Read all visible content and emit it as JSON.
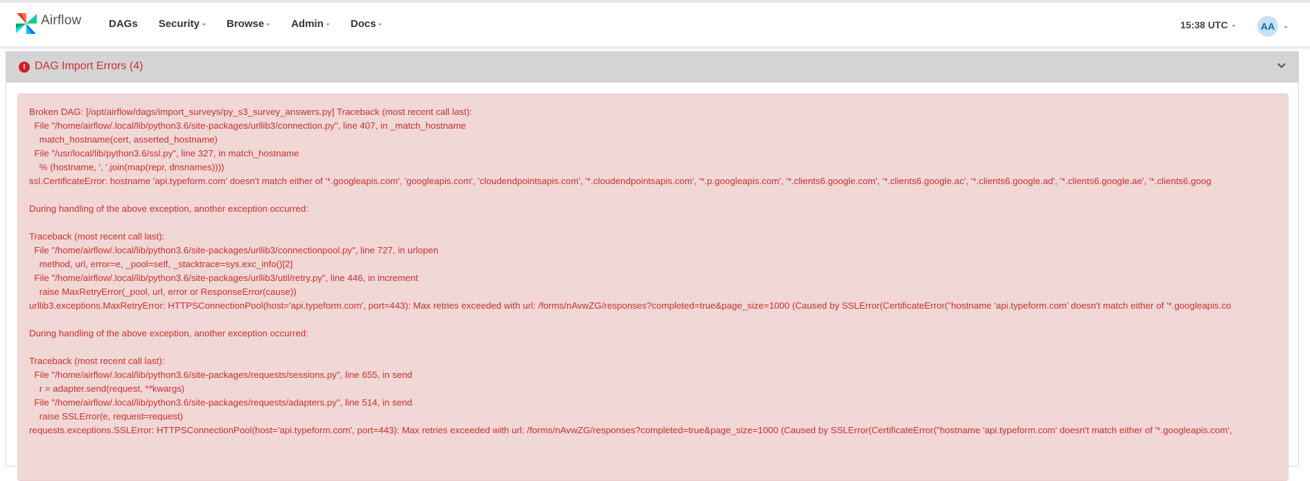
{
  "header": {
    "brand": "Airflow",
    "nav": [
      {
        "label": "DAGs",
        "has_menu": false
      },
      {
        "label": "Security",
        "has_menu": true
      },
      {
        "label": "Browse",
        "has_menu": true
      },
      {
        "label": "Admin",
        "has_menu": true
      },
      {
        "label": "Docs",
        "has_menu": true
      }
    ],
    "clock": "15:38 UTC",
    "user_initials": "AA"
  },
  "panel": {
    "title": "DAG Import Errors (4)",
    "alert_icon": "!",
    "error_lines": [
      "Broken DAG: [/opt/airflow/dags/import_surveys/py_s3_survey_answers.py] Traceback (most recent call last):",
      "  File \"/home/airflow/.local/lib/python3.6/site-packages/urllib3/connection.py\", line 407, in _match_hostname",
      "    match_hostname(cert, asserted_hostname)",
      "  File \"/usr/local/lib/python3.6/ssl.py\", line 327, in match_hostname",
      "    % (hostname, ', '.join(map(repr, dnsnames))))",
      "ssl.CertificateError: hostname 'api.typeform.com' doesn't match either of '*.googleapis.com', 'googleapis.com', 'cloudendpointsapis.com', '*.cloudendpointsapis.com', '*.p.googleapis.com', '*.clients6.google.com', '*.clients6.google.ac', '*.clients6.google.ad', '*.clients6.google.ae', '*.clients6.goog",
      "",
      "During handling of the above exception, another exception occurred:",
      "",
      "Traceback (most recent call last):",
      "  File \"/home/airflow/.local/lib/python3.6/site-packages/urllib3/connectionpool.py\", line 727, in urlopen",
      "    method, url, error=e, _pool=self, _stacktrace=sys.exc_info()[2]",
      "  File \"/home/airflow/.local/lib/python3.6/site-packages/urllib3/util/retry.py\", line 446, in increment",
      "    raise MaxRetryError(_pool, url, error or ResponseError(cause))",
      "urllib3.exceptions.MaxRetryError: HTTPSConnectionPool(host='api.typeform.com', port=443): Max retries exceeded with url: /forms/nAvwZG/responses?completed=true&page_size=1000 (Caused by SSLError(CertificateError(\"hostname 'api.typeform.com' doesn't match either of '*.googleapis.co",
      "",
      "During handling of the above exception, another exception occurred:",
      "",
      "Traceback (most recent call last):",
      "  File \"/home/airflow/.local/lib/python3.6/site-packages/requests/sessions.py\", line 655, in send",
      "    r = adapter.send(request, **kwargs)",
      "  File \"/home/airflow/.local/lib/python3.6/site-packages/requests/adapters.py\", line 514, in send",
      "    raise SSLError(e, request=request)",
      "requests.exceptions.SSLError: HTTPSConnectionPool(host='api.typeform.com', port=443): Max retries exceeded with url: /forms/nAvwZG/responses?completed=true&page_size=1000 (Caused by SSLError(CertificateError(\"hostname 'api.typeform.com' doesn't match either of '*.googleapis.com',"
    ]
  },
  "colors": {
    "error_text": "#c9302c",
    "error_bg": "#f2d7d7",
    "panel_heading_bg": "#d4d4d4",
    "avatar_bg": "#cbe0f3",
    "avatar_text": "#016bb3"
  },
  "icons": {
    "logo": "airflow-pinwheel-logo",
    "alert": "exclamation-circle-icon",
    "collapse": "chevron-down-icon",
    "menu": "caret-down-icon"
  }
}
